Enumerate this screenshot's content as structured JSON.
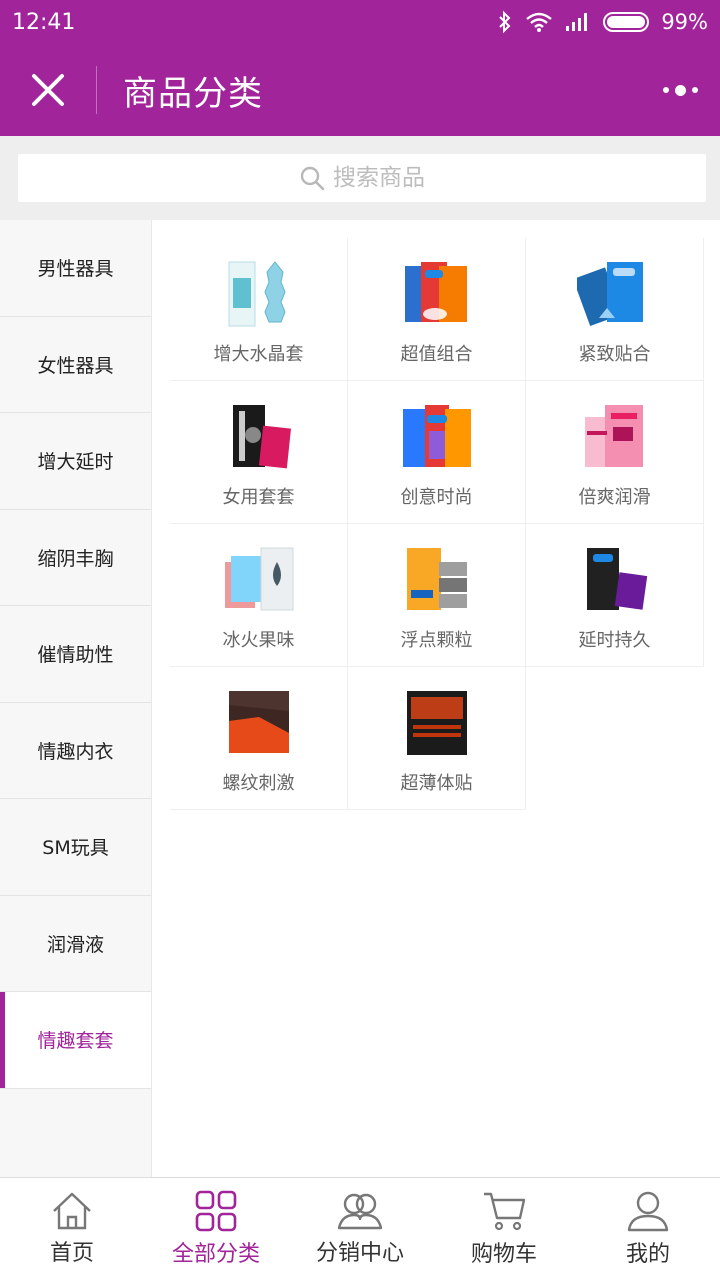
{
  "status": {
    "time": "12:41",
    "battery": "99%",
    "battery_level": 0.99
  },
  "header": {
    "title": "商品分类",
    "close_icon": "close-icon",
    "more_icon": "more-dots-icon"
  },
  "search": {
    "placeholder": "搜索商品"
  },
  "sidebar": {
    "items": [
      {
        "label": "男性器具"
      },
      {
        "label": "女性器具"
      },
      {
        "label": "增大延时"
      },
      {
        "label": "缩阴丰胸"
      },
      {
        "label": "催情助性"
      },
      {
        "label": "情趣内衣"
      },
      {
        "label": "SM玩具"
      },
      {
        "label": "润滑液"
      },
      {
        "label": "情趣套套"
      }
    ],
    "active_index": 8
  },
  "categories": [
    {
      "label": "增大水晶套"
    },
    {
      "label": "超值组合"
    },
    {
      "label": "紧致贴合"
    },
    {
      "label": "女用套套"
    },
    {
      "label": "创意时尚"
    },
    {
      "label": "倍爽润滑"
    },
    {
      "label": "冰火果味"
    },
    {
      "label": "浮点颗粒"
    },
    {
      "label": "延时持久"
    },
    {
      "label": "螺纹刺激"
    },
    {
      "label": "超薄体贴"
    }
  ],
  "nav": {
    "items": [
      {
        "label": "首页",
        "icon": "home-icon"
      },
      {
        "label": "全部分类",
        "icon": "grid-icon"
      },
      {
        "label": "分销中心",
        "icon": "people-icon"
      },
      {
        "label": "购物车",
        "icon": "cart-icon"
      },
      {
        "label": "我的",
        "icon": "user-icon"
      }
    ],
    "active_index": 1
  },
  "colors": {
    "accent": "#a1249a",
    "background": "#ffffff",
    "sidebar_bg": "#f7f7f7"
  }
}
